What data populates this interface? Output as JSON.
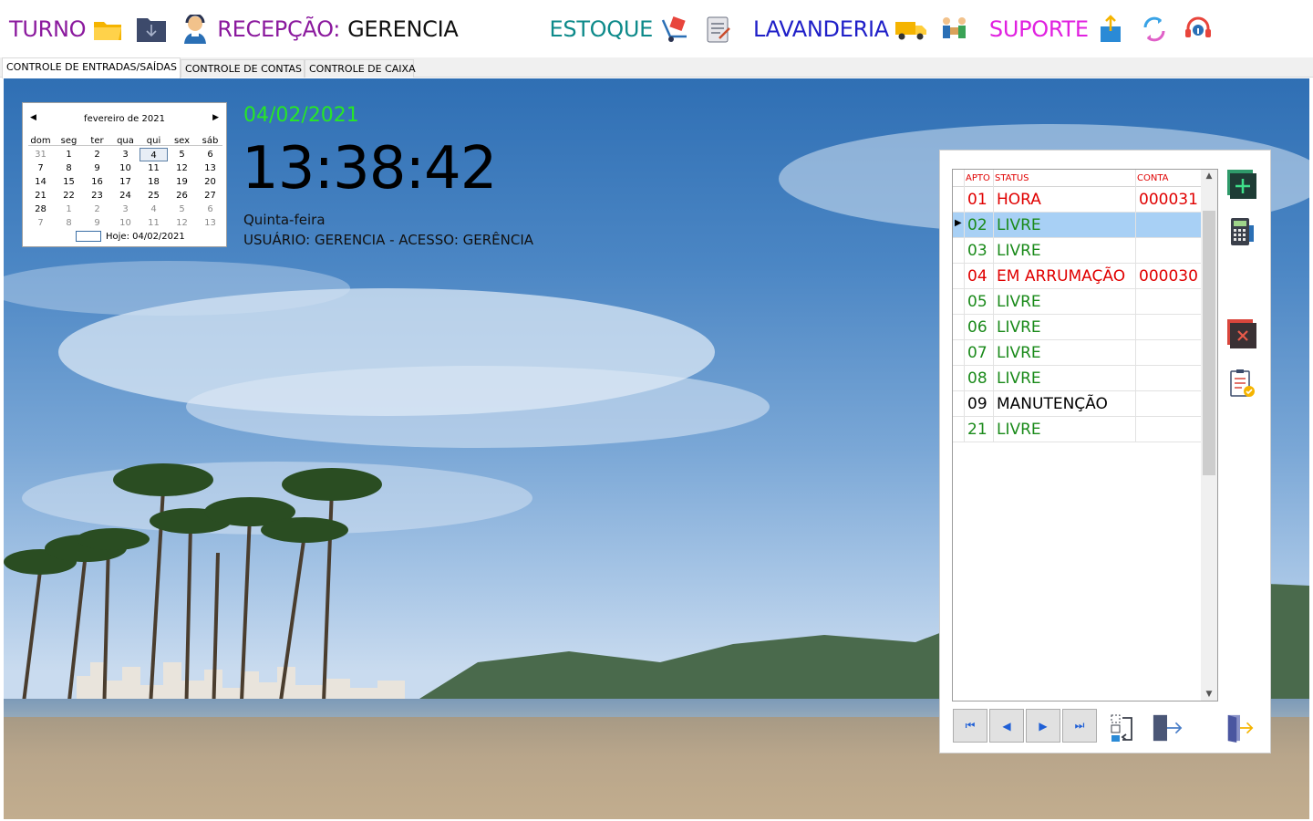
{
  "topbar": {
    "turno": "TURNO",
    "recepcao_label": "RECEPÇÃO:",
    "recepcao_value": "GERENCIA",
    "estoque": "ESTOQUE",
    "lavanderia": "LAVANDERIA",
    "suporte": "SUPORTE",
    "colors": {
      "turno": "#8b1a9e",
      "recepcao": "#8b1a9e",
      "estoque": "#0d8a8a",
      "lavanderia": "#1f1fc8",
      "suporte": "#e020e0"
    }
  },
  "tabs": [
    "CONTROLE DE ENTRADAS/SAÍDAS",
    "CONTROLE DE CONTAS",
    "CONTROLE DE CAIXA"
  ],
  "calendar": {
    "month_label": "fevereiro de 2021",
    "weekdays": [
      "dom",
      "seg",
      "ter",
      "qua",
      "qui",
      "sex",
      "sáb"
    ],
    "weeks": [
      [
        "31",
        "1",
        "2",
        "3",
        "4",
        "5",
        "6"
      ],
      [
        "7",
        "8",
        "9",
        "10",
        "11",
        "12",
        "13"
      ],
      [
        "14",
        "15",
        "16",
        "17",
        "18",
        "19",
        "20"
      ],
      [
        "21",
        "22",
        "23",
        "24",
        "25",
        "26",
        "27"
      ],
      [
        "28",
        "1",
        "2",
        "3",
        "4",
        "5",
        "6"
      ],
      [
        "7",
        "8",
        "9",
        "10",
        "11",
        "12",
        "13"
      ]
    ],
    "today_label": "Hoje: 04/02/2021"
  },
  "main": {
    "date": "04/02/2021",
    "time": "13:38:42",
    "weekday": "Quinta-feira",
    "user_line": "USUÁRIO: GERENCIA - ACESSO: GERÊNCIA"
  },
  "grid": {
    "headers": {
      "apto": "APTO",
      "status": "STATUS",
      "conta": "CONTA"
    },
    "rows": [
      {
        "apto": "01",
        "status": "HORA",
        "conta": "000031",
        "color": "#e00000"
      },
      {
        "apto": "02",
        "status": "LIVRE",
        "conta": "",
        "color": "#1a8a1a"
      },
      {
        "apto": "03",
        "status": "LIVRE",
        "conta": "",
        "color": "#1a8a1a"
      },
      {
        "apto": "04",
        "status": "EM ARRUMAÇÃO",
        "conta": "000030",
        "color": "#e00000"
      },
      {
        "apto": "05",
        "status": "LIVRE",
        "conta": "",
        "color": "#1a8a1a"
      },
      {
        "apto": "06",
        "status": "LIVRE",
        "conta": "",
        "color": "#1a8a1a"
      },
      {
        "apto": "07",
        "status": "LIVRE",
        "conta": "",
        "color": "#1a8a1a"
      },
      {
        "apto": "08",
        "status": "LIVRE",
        "conta": "",
        "color": "#1a8a1a"
      },
      {
        "apto": "09",
        "status": "MANUTENÇÃO",
        "conta": "",
        "color": "#000000"
      },
      {
        "apto": "21",
        "status": "LIVRE",
        "conta": "",
        "color": "#1a8a1a"
      }
    ]
  },
  "nav": {
    "first": "⏮",
    "prev": "◀",
    "next": "▶",
    "last": "⏭"
  }
}
